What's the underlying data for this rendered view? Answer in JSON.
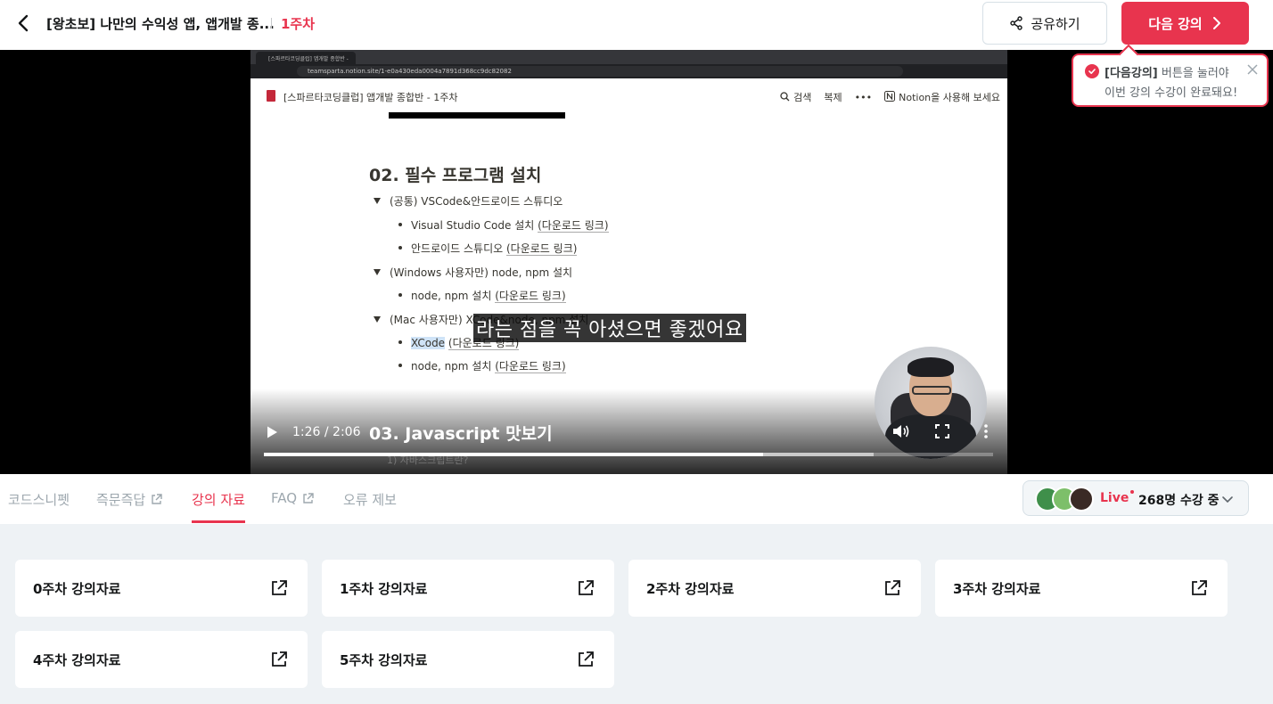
{
  "header": {
    "title": "[왕초보] 나만의 수익성 앱, 앱개발 종...",
    "week": "1주차",
    "share_label": "공유하기",
    "next_label": "다음 강의"
  },
  "tooltip": {
    "bold": "[다음강의]",
    "line1_rest": " 버튼을 눌러야",
    "line2": "이번 강의 수강이 완료돼요!"
  },
  "video": {
    "browser_tab": "[스파르타코딩클럽] 앱개발 종합반 -",
    "url": "teamsparta.notion.site/1-e0a430eda0004a7891d368cc9dc82082",
    "notion_title": "[스파르타코딩클럽] 앱개발 종합반 - 1주차",
    "notion_search": "검색",
    "notion_duplicate": "복제",
    "notion_cta": "Notion을 사용해 보세요",
    "section_heading": "02. 필수 프로그램 설치",
    "items": [
      {
        "kind": "toggle",
        "text": "(공통) VSCode&안드로이드 스튜디오"
      },
      {
        "kind": "bullet",
        "text": "Visual Studio Code 설치 ",
        "link": "(다운로드 링크)"
      },
      {
        "kind": "bullet",
        "text": "안드로이드 스튜디오 ",
        "link": "(다운로드 링크)"
      },
      {
        "kind": "toggle",
        "text": "(Windows 사용자만) node, npm 설치"
      },
      {
        "kind": "bullet",
        "text": "node, npm 설치 ",
        "link": "(다운로드 링크)"
      },
      {
        "kind": "toggle",
        "text": "(Mac 사용자만) XCode&node, npm 설치"
      },
      {
        "kind": "bullet",
        "highlight": "XCode",
        "text": " ",
        "link": "(다운로드 링크)"
      },
      {
        "kind": "bullet",
        "text": "node, npm 설치 ",
        "link": "(다운로드 링크)"
      }
    ],
    "subtitle": "라는 점을 꼭 아셨으면 좋겠어요",
    "next_heading": "03. Javascript 맛보기",
    "faded_text": "1) 자바스크립트란?",
    "time": "1:26 / 2:06",
    "progress": 0.685,
    "buffered": 0.836
  },
  "tabs": [
    {
      "label": "코드스니펫",
      "external": false,
      "active": false
    },
    {
      "label": "즉문즉답",
      "external": true,
      "active": false
    },
    {
      "label": "강의 자료",
      "external": false,
      "active": true
    },
    {
      "label": "FAQ",
      "external": true,
      "active": false
    },
    {
      "label": "오류 제보",
      "external": false,
      "active": false
    }
  ],
  "live": {
    "label": "Live",
    "count": "268명 수강 중"
  },
  "materials": [
    "0주차 강의자료",
    "1주차 강의자료",
    "2주차 강의자료",
    "3주차 강의자료",
    "4주차 강의자료",
    "5주차 강의자료"
  ],
  "colors": {
    "brand": "#e8344e",
    "tab_inactive": "#9da7ae",
    "materials_bg": "#eef2f5"
  }
}
